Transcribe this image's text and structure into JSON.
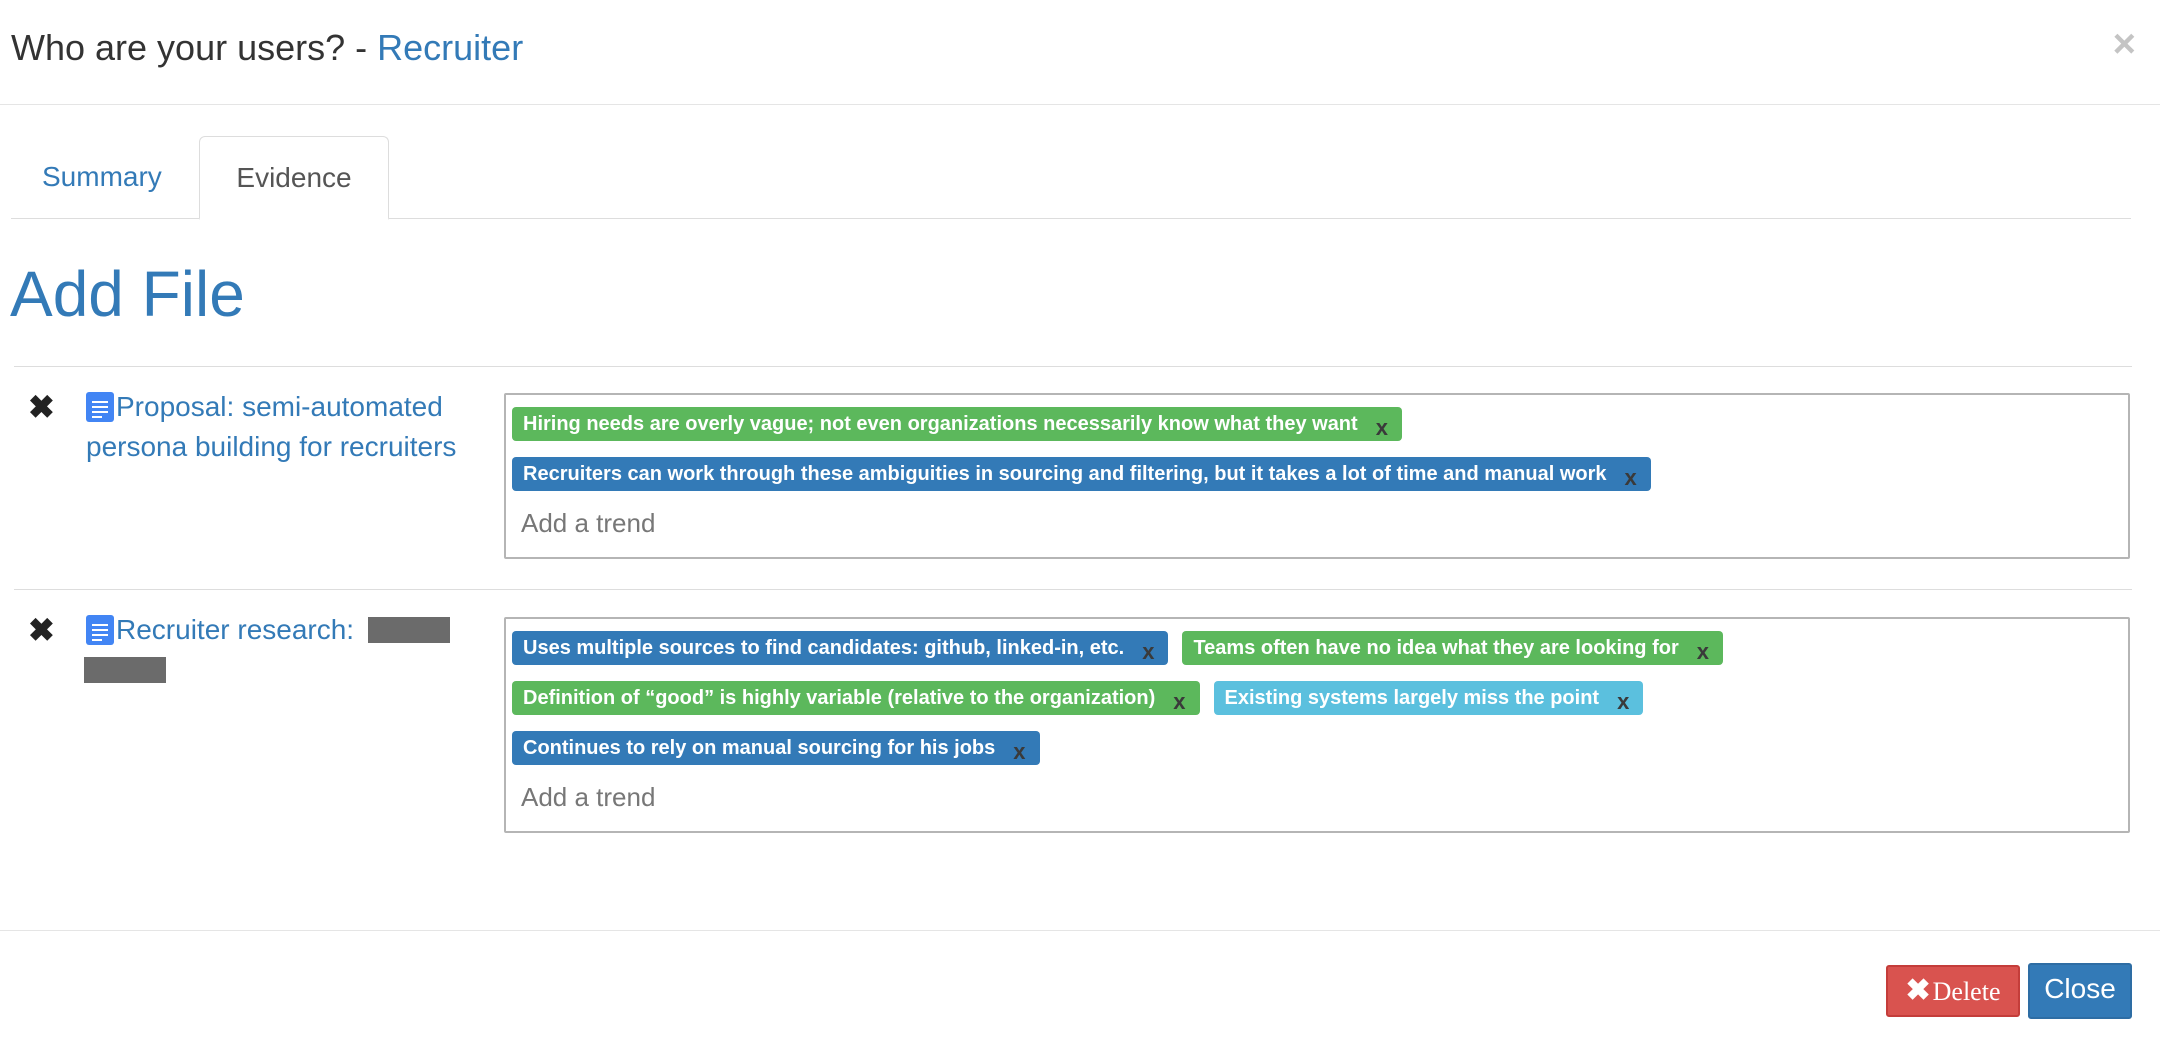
{
  "header": {
    "title": "Who are your users? - ",
    "title_accent": "Recruiter",
    "close_glyph": "×"
  },
  "tabs": [
    {
      "label": "Summary",
      "active": false
    },
    {
      "label": "Evidence",
      "active": true
    }
  ],
  "add_file_heading": "Add File",
  "remove_glyph": "✖",
  "evidence": [
    {
      "file_title": "Proposal: semi-automated persona building for recruiters",
      "icon": "google-doc-icon",
      "trends": [
        {
          "text": "Hiring needs are overly vague; not even organizations necessarily know what they want",
          "color": "#5cb85c"
        },
        {
          "text": "Recruiters can work through these ambiguities in sourcing and filtering, but it takes a lot of time and manual work",
          "color": "#337ab7"
        }
      ],
      "input_placeholder": "Add a trend"
    },
    {
      "file_title": "Recruiter research:",
      "icon": "google-doc-icon",
      "trends": [
        {
          "text": "Uses multiple sources to find candidates: github, linked-in, etc.",
          "color": "#337ab7"
        },
        {
          "text": "Teams often have no idea what they are looking for",
          "color": "#5cb85c"
        },
        {
          "text": "Definition of “good” is highly variable (relative to the organization)",
          "color": "#5cb85c"
        },
        {
          "text": "Existing systems largely miss the point",
          "color": "#5bc0de"
        },
        {
          "text": "Continues to rely on manual sourcing for his jobs",
          "color": "#337ab7"
        }
      ],
      "input_placeholder": "Add a trend"
    }
  ],
  "tag_remove_label": "x",
  "footer": {
    "delete_icon": "✖",
    "delete_label": "Delete",
    "close_label": "Close"
  }
}
